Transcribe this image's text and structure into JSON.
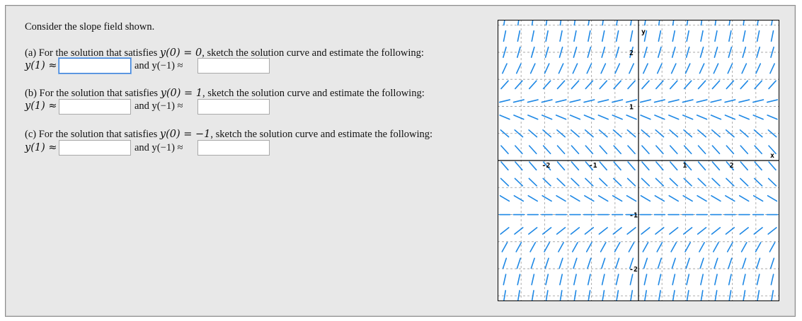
{
  "intro": "Consider the slope field shown.",
  "parts": [
    {
      "prompt": "(a) For the solution that satisfies ",
      "condition": "y(0) = 0",
      "suffix": ", sketch the solution curve and estimate the following:",
      "first_label": "y(1) ≈",
      "second_label": "and y(−1) ≈",
      "first_value": "",
      "second_value": ""
    },
    {
      "prompt": "(b) For the solution that satisfies ",
      "condition": "y(0) = 1",
      "suffix": ", sketch the solution curve and estimate the following:",
      "first_label": "y(1) ≈",
      "second_label": "and y(−1) ≈",
      "first_value": "",
      "second_value": ""
    },
    {
      "prompt": "(c) For the solution that satisfies ",
      "condition": "y(0) = −1",
      "suffix": ", sketch the solution curve and estimate the following:",
      "first_label": "y(1) ≈",
      "second_label": "and y(−1) ≈",
      "first_value": "",
      "second_value": ""
    }
  ],
  "graph": {
    "x_axis_label": "x",
    "y_axis_label": "y",
    "x_ticks": [
      "-2",
      "-1",
      "1",
      "2"
    ],
    "y_ticks": [
      "2",
      "1",
      "-1",
      "-2"
    ],
    "x_range": [
      -3,
      3
    ],
    "y_range": [
      -2.6,
      2.6
    ],
    "grid": true,
    "segment_color": "#1e88e5",
    "axis_color": "#000000",
    "grid_color": "#9a9a9a"
  }
}
